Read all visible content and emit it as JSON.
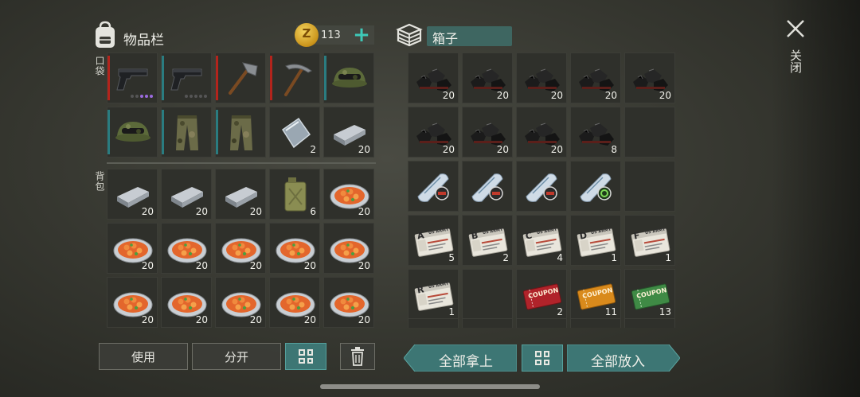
{
  "inventory": {
    "title": "物品栏",
    "coins": "113",
    "coin_symbol": "Z",
    "pocket_label": "口袋",
    "backpack_label": "背包",
    "pocket": [
      {
        "item": "pistol",
        "count": "",
        "bar": "red",
        "rarity_dots": 3
      },
      {
        "item": "pistol",
        "count": "",
        "bar": "teal",
        "rarity_dots": 0
      },
      {
        "item": "hatchet",
        "count": "",
        "bar": "red"
      },
      {
        "item": "pickaxe",
        "count": "",
        "bar": "red"
      },
      {
        "item": "cap",
        "count": "",
        "bar": "teal"
      },
      {
        "item": "cap",
        "count": "",
        "bar": "teal"
      },
      {
        "item": "pants",
        "count": "",
        "bar": "teal"
      },
      {
        "item": "pants",
        "count": "",
        "bar": "teal"
      },
      {
        "item": "plate",
        "count": "2"
      },
      {
        "item": "ingot",
        "count": "20"
      }
    ],
    "backpack": [
      {
        "item": "ingot",
        "count": "20"
      },
      {
        "item": "ingot",
        "count": "20"
      },
      {
        "item": "ingot",
        "count": "20"
      },
      {
        "item": "jerrycan",
        "count": "6"
      },
      {
        "item": "stew",
        "count": "20"
      },
      {
        "item": "stew",
        "count": "20"
      },
      {
        "item": "stew",
        "count": "20"
      },
      {
        "item": "stew",
        "count": "20"
      },
      {
        "item": "stew",
        "count": "20"
      },
      {
        "item": "stew",
        "count": "20"
      },
      {
        "item": "stew",
        "count": "20"
      },
      {
        "item": "stew",
        "count": "20"
      },
      {
        "item": "stew",
        "count": "20"
      },
      {
        "item": "stew",
        "count": "20"
      },
      {
        "item": "stew",
        "count": "20"
      }
    ],
    "buttons": {
      "use": "使用",
      "split": "分开"
    }
  },
  "box": {
    "title": "箱子",
    "slots": [
      {
        "item": "coal",
        "count": "20"
      },
      {
        "item": "coal",
        "count": "20"
      },
      {
        "item": "coal",
        "count": "20"
      },
      {
        "item": "coal",
        "count": "20"
      },
      {
        "item": "coal",
        "count": "20"
      },
      {
        "item": "coal",
        "count": "20"
      },
      {
        "item": "coal",
        "count": "20"
      },
      {
        "item": "coal",
        "count": "20"
      },
      {
        "item": "coal",
        "count": "8"
      },
      {
        "item": "",
        "count": ""
      },
      {
        "item": "blueprint",
        "count": ""
      },
      {
        "item": "blueprint",
        "count": ""
      },
      {
        "item": "blueprint",
        "count": ""
      },
      {
        "item": "blueprint-bio",
        "count": ""
      },
      {
        "item": "",
        "count": ""
      },
      {
        "item": "card",
        "letter": "A",
        "header": "US ARMY",
        "count": "5"
      },
      {
        "item": "card",
        "letter": "B",
        "header": "US ARMY",
        "count": "2"
      },
      {
        "item": "card",
        "letter": "C",
        "header": "US ARMY",
        "count": "4"
      },
      {
        "item": "card",
        "letter": "D",
        "header": "US ARMY",
        "count": "1"
      },
      {
        "item": "card",
        "letter": "F",
        "header": "US ARMY",
        "count": "1"
      },
      {
        "item": "card",
        "letter": "R",
        "header": "US ARMY",
        "count": "1"
      },
      {
        "item": "",
        "count": ""
      },
      {
        "item": "coupon-red",
        "label": "COUPON",
        "count": "2"
      },
      {
        "item": "coupon-orange",
        "label": "COUPON",
        "count": "11"
      },
      {
        "item": "coupon-green",
        "label": "COUPON",
        "count": "13"
      }
    ],
    "buttons": {
      "take_all": "全部拿上",
      "put_all": "全部放入"
    }
  },
  "close_label": "关闭",
  "colors": {
    "accent": "#3d7674",
    "bar_teal": "#2a7c80",
    "bar_red": "#b3241c",
    "plus": "#3ec9b8"
  }
}
